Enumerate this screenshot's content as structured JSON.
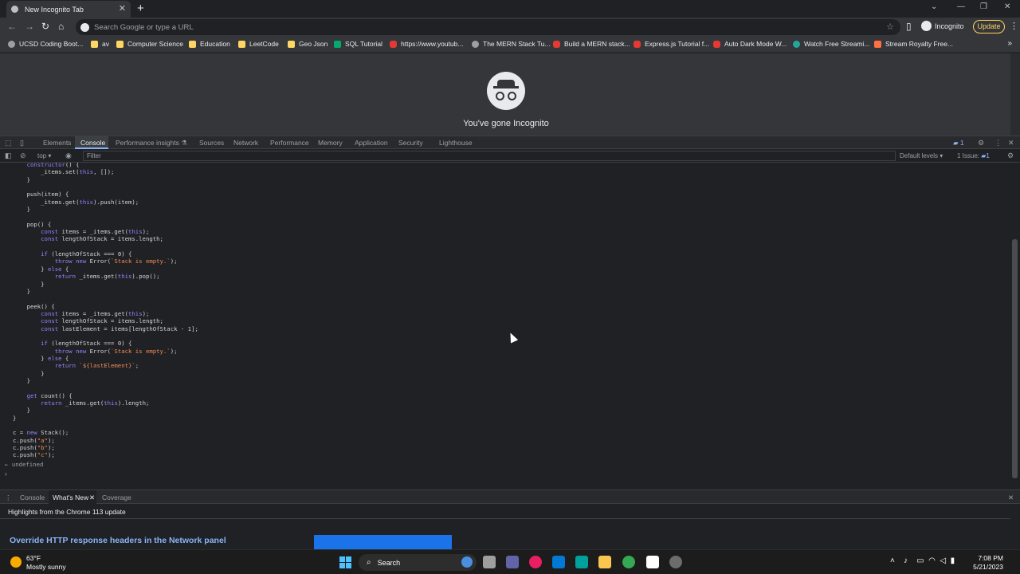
{
  "browser": {
    "tab_title": "New Incognito Tab",
    "tab_close": "✕",
    "new_tab": "+",
    "omnibox_placeholder": "Search Google or type a URL",
    "incognito_label": "Incognito",
    "update_label": "Update",
    "menu": "⋮"
  },
  "bookmarks": [
    {
      "label": "UCSD Coding Boot...",
      "icon": "globe"
    },
    {
      "label": "av",
      "icon": "folder"
    },
    {
      "label": "Computer Science",
      "icon": "folder"
    },
    {
      "label": "Education",
      "icon": "folder"
    },
    {
      "label": "LeetCode",
      "icon": "folder"
    },
    {
      "label": "Geo Json",
      "icon": "folder"
    },
    {
      "label": "SQL Tutorial",
      "icon": "w3"
    },
    {
      "label": "https://www.youtub...",
      "icon": "yt"
    },
    {
      "label": "The MERN Stack Tu...",
      "icon": "globe"
    },
    {
      "label": "Build a MERN stack...",
      "icon": "yt"
    },
    {
      "label": "Express.js Tutorial f...",
      "icon": "yt"
    },
    {
      "label": "Auto Dark Mode W...",
      "icon": "yt"
    },
    {
      "label": "Watch Free Streami...",
      "icon": "teal"
    },
    {
      "label": "Stream Royalty Free...",
      "icon": "orange"
    }
  ],
  "page": {
    "incognito_heading": "You've gone Incognito"
  },
  "devtools": {
    "tabs": [
      "Elements",
      "Console",
      "Performance insights ⚗",
      "Sources",
      "Network",
      "Performance",
      "Memory",
      "Application",
      "Security",
      "Lighthouse"
    ],
    "active_tab": "Console",
    "badge": "1",
    "context": "top ▾",
    "filter_placeholder": "Filter",
    "levels": "Default levels ▾",
    "issues": "1 Issue: ",
    "issues_count": "1",
    "return_value": "undefined",
    "prompt": "›"
  },
  "drawer": {
    "tabs": [
      "Console",
      "What's New",
      "Coverage"
    ],
    "active_tab": "What's New",
    "highlights": "Highlights from the Chrome 113 update",
    "article_title": "Override HTTP response headers in the Network panel"
  },
  "taskbar": {
    "weather_temp": "63°F",
    "weather_desc": "Mostly sunny",
    "search_label": "Search",
    "time": "7:08 PM",
    "date": "5/21/2023"
  }
}
